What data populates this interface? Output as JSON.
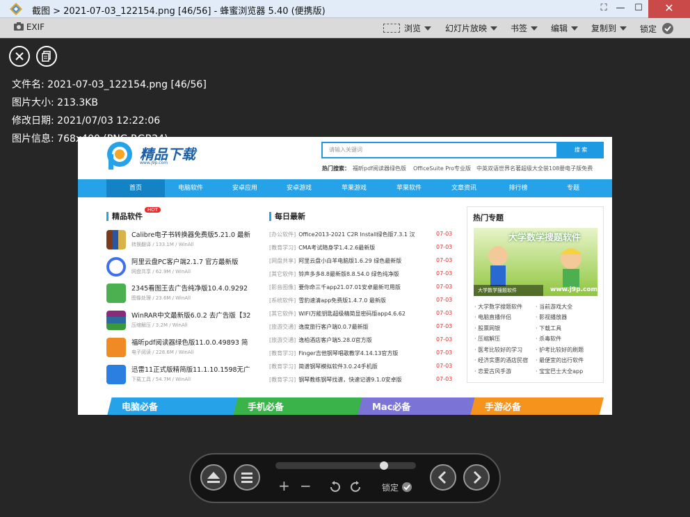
{
  "window": {
    "title": "截图 > 2021-07-03_122154.png [46/56] - 蜂蜜浏览器 5.40 (便携版)"
  },
  "toolbar": {
    "exif": "EXIF",
    "browse": "浏览",
    "slideshow": "幻灯片放映",
    "bookmark": "书签",
    "edit": "编辑",
    "copy_to": "复制到",
    "lock": "锁定"
  },
  "info": {
    "filename": "文件名: 2021-07-03_122154.png [46/56]",
    "filesize": "图片大小: 213.3KB",
    "modified": "修改日期: 2021/07/03 12:22:06",
    "imageinfo": "图片信息: 768x400 (PNG,RGB24)"
  },
  "site": {
    "logo_text": "精品下载",
    "logo_url": "www.j9p.com",
    "search_placeholder": "请输入关键词",
    "search_btn": "搜 索",
    "hot_search_label": "热门搜索：",
    "hot_search": [
      "福昕pdf阅读器绿色版",
      "OfficeSuite Pro专业版",
      "中英双语世界名著超级大全装108册电子版免费"
    ],
    "nav": [
      "首页",
      "电脑软件",
      "安卓应用",
      "安卓游戏",
      "苹果游戏",
      "苹果软件",
      "文章资讯",
      "排行榜",
      "专题"
    ],
    "sec_soft": "精品软件",
    "hot_badge": "HOT",
    "sec_daily": "每日最新",
    "sec_topic": "热门专题",
    "soft": [
      {
        "name": "Calibre电子书转换器免费版5.21.0 最新",
        "meta": "转换翻译 / 133.1M / WinAll"
      },
      {
        "name": "阿里云盘PC客户端2.1.7 官方最新版",
        "meta": "网盘共享 / 62.9M / WinAll"
      },
      {
        "name": "2345看图王去广告纯净版10.4.0.9292",
        "meta": "图像处理 / 23.6M / WinAll"
      },
      {
        "name": "WinRAR中文最新版6.0.2 去广告版【32",
        "meta": "压缩解压 / 3.2M / WinAll"
      },
      {
        "name": "福昕pdf阅读器绿色版11.0.0.49893 简",
        "meta": "电子阅读 / 228.6M / WinAll"
      },
      {
        "name": "迅雷11正式版精简版11.1.10.1598无广",
        "meta": "下载工具 / 54.7M / WinAll"
      }
    ],
    "daily": [
      {
        "cat": "[办公软件]",
        "name": "Office2013-2021 C2R Install绿色版7.3.1 汉",
        "date": "07-03"
      },
      {
        "cat": "[教育学习]",
        "name": "CMA考试随身学1.4.2.6最新版",
        "date": "07-03"
      },
      {
        "cat": "[网盘共享]",
        "name": "阿里云盘小白羊电脑版1.6.29 绿色最新版",
        "date": "07-03"
      },
      {
        "cat": "[其它软件]",
        "name": "铃声多多8.8最新版8.8.54.0 绿色纯净版",
        "date": "07-03"
      },
      {
        "cat": "[影音图像]",
        "name": "要你命三千app21.07.01安卓最新可用版",
        "date": "07-03"
      },
      {
        "cat": "[系统软件]",
        "name": "雪豹速清app免费版1.4.7.0 最新版",
        "date": "07-03"
      },
      {
        "cat": "[其它软件]",
        "name": "WIFI万能钥匙超级精简显密码版app4.6.62",
        "date": "07-03"
      },
      {
        "cat": "[旅游交通]",
        "name": "逸度旅行客户端0.0.7最新版",
        "date": "07-03"
      },
      {
        "cat": "[旅游交通]",
        "name": "逸柏酒店客户端5.28.0官方版",
        "date": "07-03"
      },
      {
        "cat": "[教育学习]",
        "name": "Finger吉他钢琴唱歌教学4.14.13官方版",
        "date": "07-03"
      },
      {
        "cat": "[教育学习]",
        "name": "简谱钢琴模拟软件3.0.24手机版",
        "date": "07-03"
      },
      {
        "cat": "[教育学习]",
        "name": "钢琴教练钢琴找谱，快速记谱9.1.0安卓版",
        "date": "07-03"
      }
    ],
    "topic_img_title": "大学数学搜题软件",
    "topic_caption": "大学数学搜题软件",
    "topic_url": "www.j9p.com",
    "topics_left": [
      "大学数学搜题软件",
      "电脑直播伴侣",
      "股票网银",
      "压缩解压",
      "医考比较好的学习",
      "经济实惠的酒店民宿",
      "恋爱古风手游"
    ],
    "topics_right": [
      "当前游戏大全",
      "影视播放器",
      "下载工具",
      "杀毒软件",
      "护考比较好的刷题",
      "最便宜的出行软件",
      "宝宝巴士大全app"
    ],
    "banners": [
      "电脑必备",
      "手机必备",
      "Mac必备",
      "手游必备"
    ]
  },
  "controls": {
    "lock": "锁定",
    "zoom_in": "+",
    "zoom_out": "−",
    "zoom_slider_fraction": 0.79
  }
}
